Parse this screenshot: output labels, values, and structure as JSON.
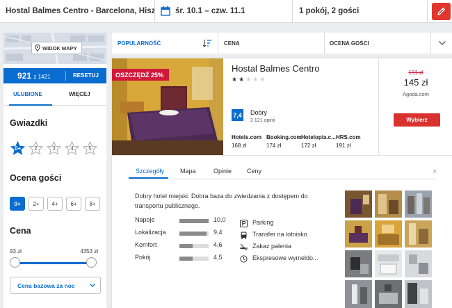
{
  "search": {
    "destination": "Hostal Balmes Centro - Barcelona, Hisz",
    "dates": "śr. 10.1  –  czw. 11.1",
    "rooms_guests": "1 pokój, 2 gości"
  },
  "sidebar": {
    "map_button": "WIDOK MAPY",
    "results_count": "921",
    "results_total": "z 1421",
    "reset_label": "RESETUJ",
    "tabs": [
      "ULUBIONE",
      "WIĘCEJ"
    ],
    "stars_title": "Gwiazdki",
    "star_options": [
      "0+",
      "2",
      "3",
      "4",
      "5"
    ],
    "rating_title": "Ocena gości",
    "rating_options": [
      "0+",
      "2+",
      "4+",
      "6+",
      "8+"
    ],
    "price_title": "Cena",
    "price_min": "93 zł",
    "price_max": "4353 zł",
    "nightly_select": "Cena bazowa za noc"
  },
  "sort": {
    "options": [
      "POPULARNOŚĆ",
      "CENA",
      "OCENA GOŚCI"
    ]
  },
  "hotel": {
    "name": "Hostal Balmes Centro",
    "stars": 2,
    "discount_badge": "OSZCZĘDŹ 25%",
    "score": "7,4",
    "score_label": "Dobry",
    "reviews": "2 121 opinii",
    "partners": [
      {
        "name": "Hotels.com",
        "price": "168 zł"
      },
      {
        "name": "Booking.com",
        "price": "174 zł"
      },
      {
        "name": "Hotelopia.c...",
        "price": "172 zł"
      },
      {
        "name": "HRS.com",
        "price": "191 zł"
      }
    ],
    "old_price": "191 zł",
    "price": "145 zł",
    "best_site": "Agoda.com",
    "cta": "Wybierz"
  },
  "details": {
    "tabs": [
      "Szczegóły",
      "Mapa",
      "Opinie",
      "Ceny"
    ],
    "close": "×",
    "description": "Dobry hotel miejski. Dobra baza do zwiedzania z dostępem do transportu publicznego.",
    "ratings": [
      {
        "label": "Napoje",
        "value": "10,0",
        "score": 10.0
      },
      {
        "label": "Lokalizacja",
        "value": "9,4",
        "score": 9.4
      },
      {
        "label": "Komfort",
        "value": "4,6",
        "score": 4.6
      },
      {
        "label": "Pokój",
        "value": "4,5",
        "score": 4.5
      }
    ],
    "amenities": [
      {
        "label": "Parking",
        "icon": "parking-icon"
      },
      {
        "label": "Transfer na lotnisko",
        "icon": "bus-icon"
      },
      {
        "label": "Zakaz palenia",
        "icon": "no-smoking-icon"
      },
      {
        "label": "Ekspresowe wymeldo...",
        "icon": "express-checkout-icon"
      }
    ]
  },
  "colors": {
    "accent": "#0a6ccf",
    "cta": "#d9322e",
    "badge": "#d1193b"
  }
}
